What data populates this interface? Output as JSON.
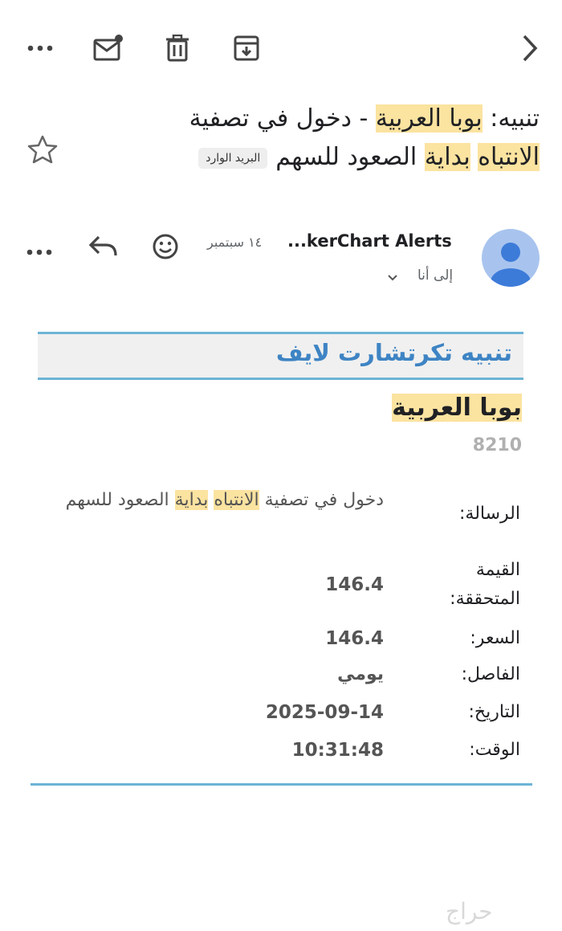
{
  "subject": {
    "prefix": "تنبيه: ",
    "name_hl": "بوبا العربية",
    "middle": " - دخول في تصفية ",
    "hl1": "الانتباه",
    "space": " ",
    "hl2": "بداية",
    "suffix": " الصعود للسهم",
    "badge": "البريد الوارد"
  },
  "message": {
    "sender": "...kerChart Alerts",
    "date": "١٤ سبتمبر",
    "to": "إلى أنا"
  },
  "card": {
    "title": "تنبيه تكرتشارت لايف",
    "symbol_name": "بوبا العربية",
    "symbol_code": "8210",
    "rows": [
      {
        "label": "الرسالة:",
        "value_pre": "دخول في تصفية ",
        "value_hl1": "الانتباه",
        "value_sp": " ",
        "value_hl2": "بداية",
        "value_post": " الصعود للسهم"
      },
      {
        "label": "القيمة المتحققة:",
        "value": "146.4"
      },
      {
        "label": "السعر:",
        "value": "146.4"
      },
      {
        "label": "الفاصل:",
        "value": "يومي"
      },
      {
        "label": "التاريخ:",
        "value": "2025-09-14"
      },
      {
        "label": "الوقت:",
        "value": "10:31:48"
      }
    ]
  },
  "watermark": "حراج",
  "icons": [
    "more-icon",
    "mark-unread-icon",
    "trash-icon",
    "archive-icon",
    "back-chevron-icon",
    "star-icon",
    "avatar-icon",
    "emoji-icon",
    "reply-icon",
    "message-more-icon",
    "expand-chevron-icon"
  ],
  "colors": {
    "accent": "#3e84c4",
    "rule": "#6cb4d6",
    "highlight": "#fbe3a0"
  }
}
